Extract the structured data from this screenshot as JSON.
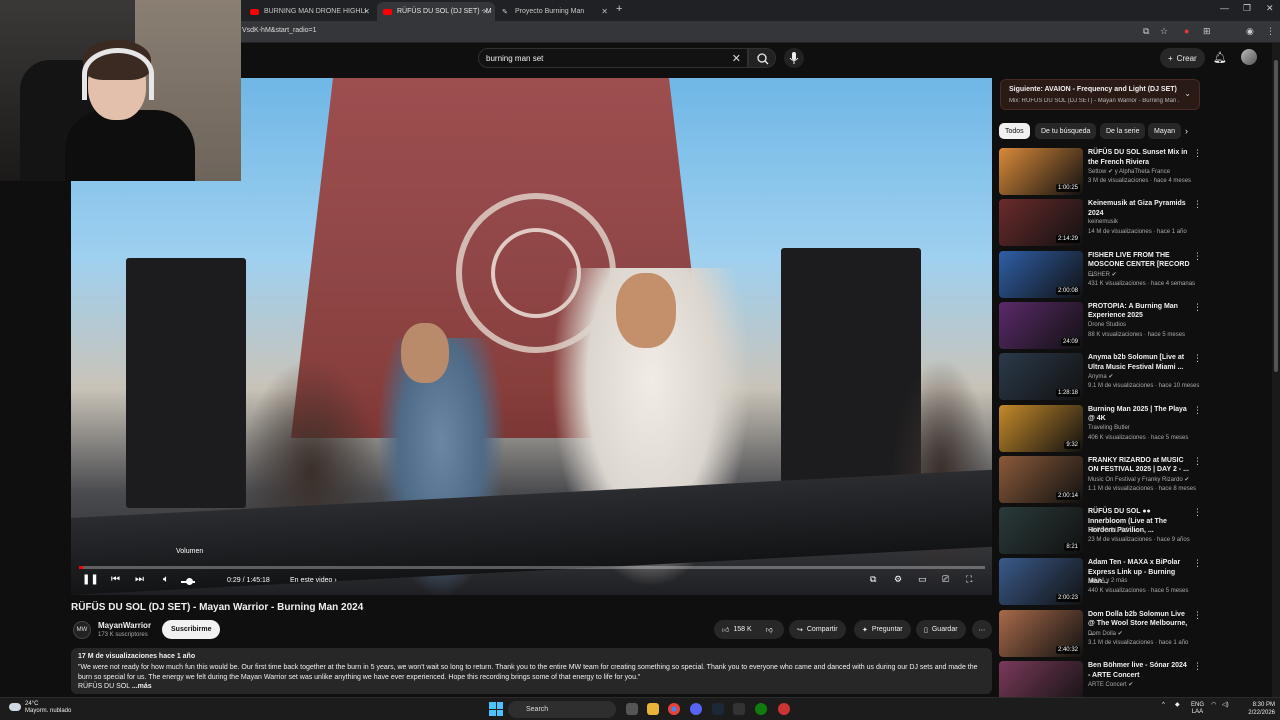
{
  "browser": {
    "tabs": [
      {
        "label": "BURNING MAN DRONE HIGHLI"
      },
      {
        "label": "RÜFÜS DU SOL (DJ SET) - M"
      },
      {
        "label": "Proyecto Burning Man"
      }
    ],
    "url": "VsdK-hM&start_radio=1"
  },
  "header": {
    "search_value": "burning man set",
    "create_label": "Crear"
  },
  "player": {
    "tooltip": "Volumen",
    "time": "0:29 / 1:45:18",
    "chapter": "En este video",
    "progress_fraction": 0.0046
  },
  "video": {
    "title": "RÜFÜS DU SOL (DJ SET) - Mayan Warrior - Burning Man 2024",
    "channel": "MayanWarrior",
    "channel_avatar": "MW",
    "subscribers": "173 K suscriptores",
    "subscribe_label": "Suscribirme",
    "likes": "158 K",
    "share_label": "Compartir",
    "ask_label": "Preguntar",
    "save_label": "Guardar",
    "description": {
      "meta": "17 M de visualizaciones  hace 1 año",
      "text": "\"We were not ready for how much fun this would be. Our first time back together at the burn in 5 years, we won't wait so long to return. Thank you to the entire MW team for creating something so special. Thank you to everyone who came and danced with us during our DJ sets and made the burn so special for us. The energy we felt during the Mayan Warrior set was unlike anything we have ever experienced. Hope this recording brings some of that energy to life for you.\"",
      "footer": "RÜFÜS DU SOL",
      "more": "...más"
    }
  },
  "sidebar": {
    "up_next": {
      "title": "Siguiente: AVAION - Frequency and Light (DJ SET)",
      "subtitle": "Mix: RÜFÜS DU SOL (DJ SET) - Mayan Warrior - Burning Man ..."
    },
    "chips": [
      "Todos",
      "De tu búsqueda",
      "De la serie",
      "Mayan"
    ],
    "items": [
      {
        "title": "RÜFÜS DU SOL Sunset Mix in the French Riviera",
        "channel": "Settow ✔ y AlphaTheta France",
        "meta": "3 M de visualizaciones · hace 4 meses",
        "duration": "1:00:25",
        "color": "#d98a3a"
      },
      {
        "title": "Keinemusik at Giza Pyramids 2024",
        "channel": "keinemusik",
        "meta": "14 M de visualizaciones · hace 1 año",
        "duration": "2:14:29",
        "color": "#6b2b2b"
      },
      {
        "title": "FISHER LIVE FROM THE MOSCONE CENTER [RECORD ...",
        "channel": "FISHER ✔",
        "meta": "431 K visualizaciones · hace 4 semanas",
        "duration": "2:00:08",
        "color": "#2f5fa8"
      },
      {
        "title": "PROTOPIA: A Burning Man Experience 2025",
        "channel": "Drone Studios",
        "meta": "88 K visualizaciones · hace 5 meses",
        "duration": "24:09",
        "color": "#5a2a6a"
      },
      {
        "title": "Anyma b2b Solomun [Live at Ultra Music Festival Miami ...",
        "channel": "Anyma ✔",
        "meta": "9.1 M de visualizaciones · hace 10 meses",
        "duration": "1:28:18",
        "color": "#2b3a4a"
      },
      {
        "title": "Burning Man 2025 | The Playa @ 4K",
        "channel": "Traveling Butler",
        "meta": "406 K visualizaciones · hace 5 meses",
        "duration": "9:32",
        "color": "#c48a2a"
      },
      {
        "title": "FRANKY RIZARDO at MUSIC ON FESTIVAL 2025 | DAY 2 - ...",
        "channel": "Music On Festival y Franky Rizardo ✔",
        "meta": "1.1 M de visualizaciones · hace 8 meses",
        "duration": "2:00:14",
        "color": "#8a5a3a"
      },
      {
        "title": "RÜFÜS DU SOL ●● Innerbloom (Live at The Hordern Pavilion, ...",
        "channel": "RÜFÜS DU SOL ✔",
        "meta": "23 M de visualizaciones · hace 9 años",
        "duration": "8:21",
        "color": "#2a3a3a"
      },
      {
        "title": "Adam Ten - MAXA x BiPolar Express Link up - Burning Man...",
        "channel": "MAXA y 2 más",
        "meta": "440 K visualizaciones · hace 5 meses",
        "duration": "2:00:23",
        "color": "#3a5a8a"
      },
      {
        "title": "Dom Dolla b2b Solomun Live @ The Wool Store Melbourne, ...",
        "channel": "Dom Dolla ✔",
        "meta": "3.1 M de visualizaciones · hace 1 año",
        "duration": "2:40:32",
        "color": "#a86a4a"
      },
      {
        "title": "Ben Böhmer live - Sónar 2024 - ARTE Concert",
        "channel": "ARTE Concert ✔",
        "meta": "",
        "duration": "",
        "color": "#7a3a5a"
      }
    ]
  },
  "taskbar": {
    "weather_temp": "24°C",
    "weather_desc": "Mayorm. nublado",
    "search_label": "Search",
    "lang": "ENG",
    "lang2": "LAA",
    "time": "8:30 PM",
    "date": "2/22/2026"
  }
}
